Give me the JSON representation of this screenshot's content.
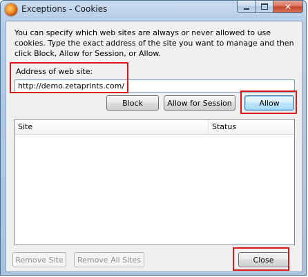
{
  "window": {
    "title": "Exceptions - Cookies",
    "close_symbol": "✕"
  },
  "intro_text": "You can specify which web sites are always or never allowed to use cookies. Type the exact address of the site you want to manage and then click Block, Allow for Session, or Allow.",
  "address": {
    "label": "Address of web site:",
    "value": "http://demo.zetaprints.com/"
  },
  "buttons": {
    "block": "Block",
    "allow_session": "Allow for Session",
    "allow": "Allow",
    "remove_site": "Remove Site",
    "remove_all_sites": "Remove All Sites",
    "close": "Close"
  },
  "table": {
    "columns": [
      "Site",
      "Status"
    ],
    "rows": []
  },
  "colors": {
    "highlight": "#d7191c",
    "default_button_border": "#3c7fb1"
  }
}
